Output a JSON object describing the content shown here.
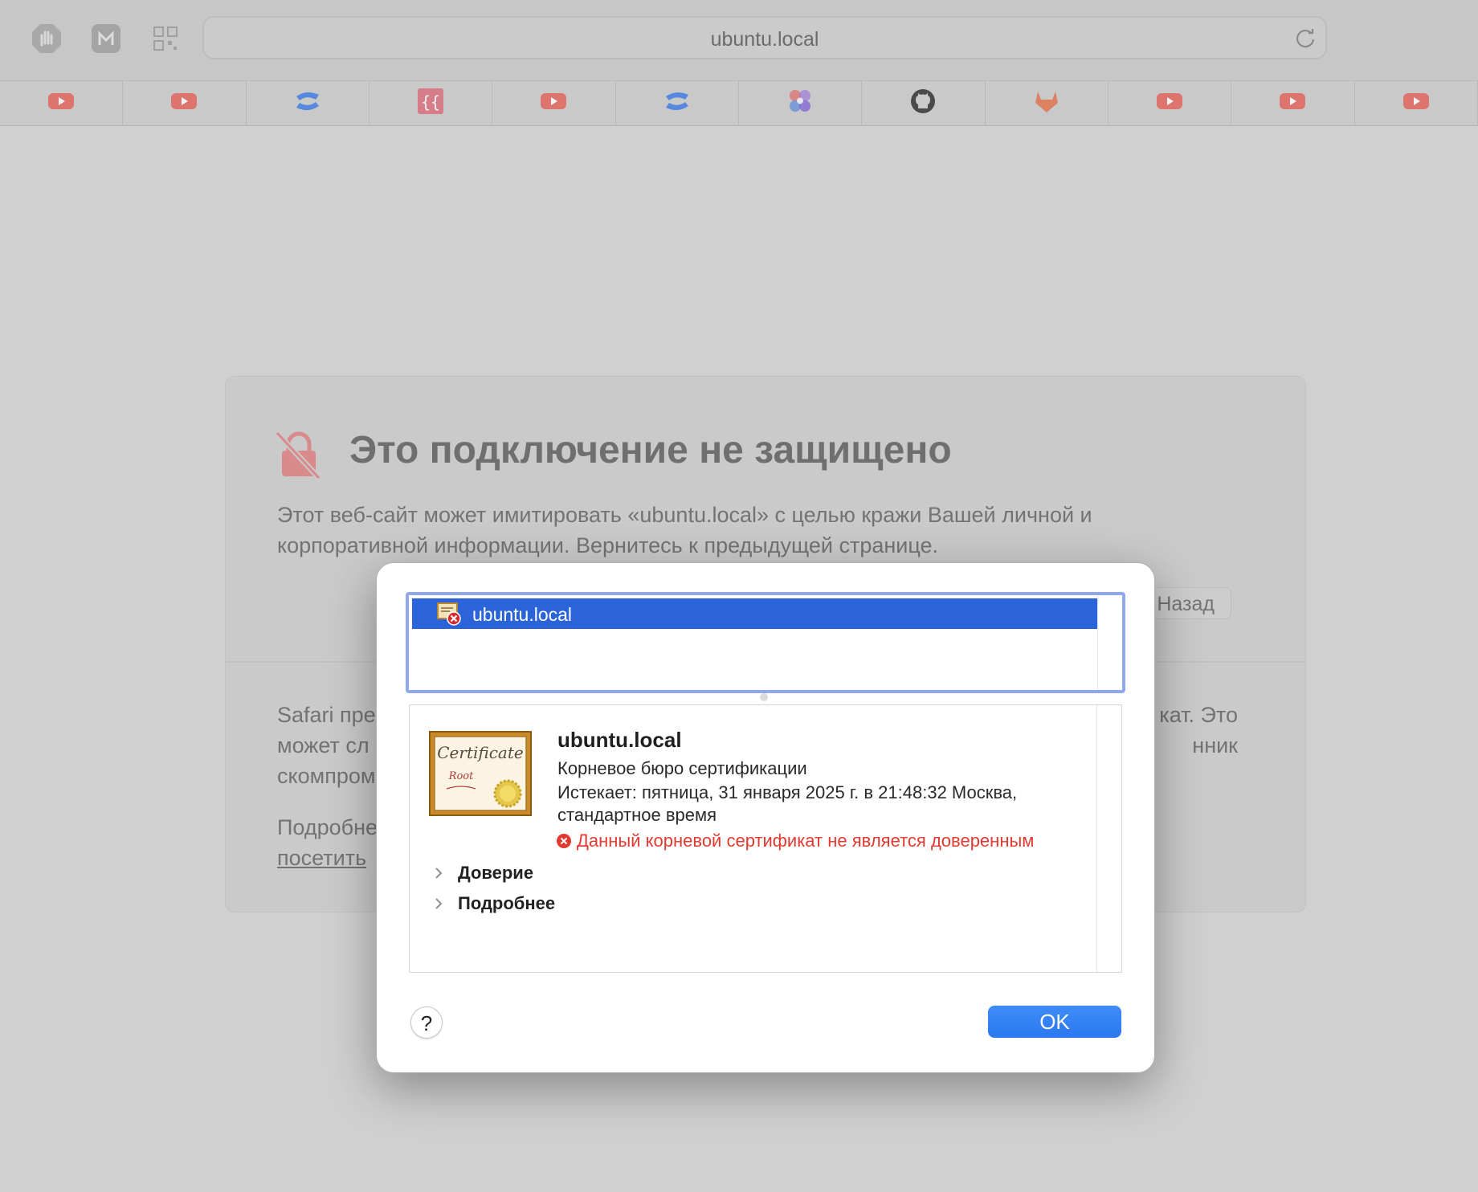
{
  "browser": {
    "address": "ubuntu.local",
    "toolbar_icons": [
      "stop-hand-icon",
      "extension-m-icon",
      "qr-code-icon"
    ],
    "favorites": [
      {
        "icon": "youtube-icon",
        "color": "#e8473d"
      },
      {
        "icon": "youtube-icon",
        "color": "#e8473d"
      },
      {
        "icon": "confluence-icon",
        "color": "#2f73e4"
      },
      {
        "icon": "code-brackets-icon",
        "color": "#e04b5f"
      },
      {
        "icon": "youtube-icon",
        "color": "#e8473d"
      },
      {
        "icon": "confluence-icon",
        "color": "#2f73e4"
      },
      {
        "icon": "four-dots-icon",
        "color": "#7a5cd6"
      },
      {
        "icon": "github-icon",
        "color": "#222222"
      },
      {
        "icon": "gitlab-icon",
        "color": "#e2633a"
      },
      {
        "icon": "youtube-icon",
        "color": "#e8473d"
      },
      {
        "icon": "youtube-icon",
        "color": "#e8473d"
      },
      {
        "icon": "youtube-icon",
        "color": "#e8473d"
      }
    ]
  },
  "warning_page": {
    "title": "Это подключение не защищено",
    "description_line1": "Этот веб-сайт может имитировать «ubuntu.local» с целью кражи Вашей личной и",
    "description_line2": "корпоративной информации. Вернитесь к предыдущей странице.",
    "back_button": "Назад",
    "body_left_1": "Safari пре",
    "body_left_2": "может сл",
    "body_left_3": "скомпром",
    "body_right_1": "кат. Это",
    "body_right_2": "нник",
    "more_left": "Подробне",
    "visit_link": "посетить"
  },
  "cert_dialog": {
    "list_item": "ubuntu.local",
    "cert_image_text": [
      "Certificate",
      "Root"
    ],
    "cert_name": "ubuntu.local",
    "cert_type": "Корневое бюро сертификации",
    "expires_line1": "Истекает: пятница, 31 января 2025 г. в 21:48:32 Москва,",
    "expires_line2": "стандартное время",
    "error_text": "Данный корневой сертификат не является доверенным",
    "disclosures": [
      "Доверие",
      "Подробнее"
    ],
    "help_label": "?",
    "ok_label": "OK",
    "colors": {
      "selection": "#2b64d9",
      "error": "#e23a30",
      "ok_button": "#3583f4"
    }
  }
}
